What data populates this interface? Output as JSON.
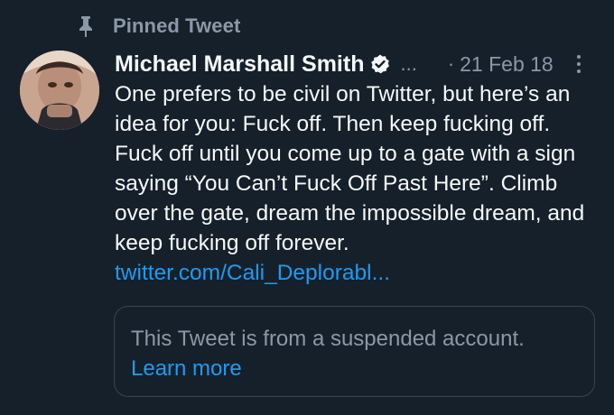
{
  "pinned": {
    "label": "Pinned Tweet"
  },
  "tweet": {
    "author_name": "Michael Marshall Smith",
    "handle_truncated": "...",
    "separator": "·",
    "timestamp": "21 Feb 18",
    "text": "One prefers to be civil on Twitter, but here’s an idea for you: Fuck off. Then keep fucking off. Fuck off until you come up to a gate with a sign saying “You Can’t Fuck Off Past Here”. Climb over the gate, dream the impossible dream, and keep fucking off forever.",
    "link_text": "twitter.com/Cali_Deplorabl..."
  },
  "quoted_card": {
    "message": "This Tweet is from a suspended account.",
    "learn_more": "Learn more"
  },
  "colors": {
    "background": "#15202b",
    "primary_text": "#f7f9f9",
    "secondary_text": "#8b98a5",
    "link": "#1d9bf0",
    "border": "#38444d"
  },
  "icons": {
    "pin": "pin-icon",
    "verified": "verified-badge-icon",
    "more": "more-options-icon"
  }
}
